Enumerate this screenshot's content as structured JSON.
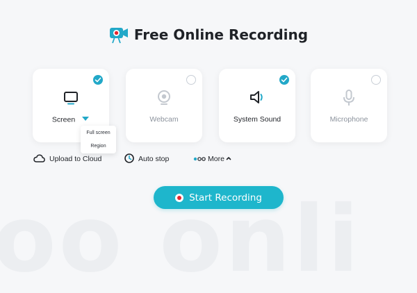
{
  "header": {
    "title": "Free Online Recording"
  },
  "cards": [
    {
      "label": "Screen",
      "checked": true,
      "icon": "monitor-icon"
    },
    {
      "label": "Webcam",
      "checked": false,
      "icon": "webcam-icon"
    },
    {
      "label": "System Sound",
      "checked": true,
      "icon": "speaker-icon"
    },
    {
      "label": "Microphone",
      "checked": false,
      "icon": "microphone-icon"
    }
  ],
  "screen_dropdown": {
    "options": [
      "Full screen",
      "Region"
    ]
  },
  "options": {
    "upload": "Upload to Cloud",
    "autostop": "Auto stop",
    "more": "More"
  },
  "start_button": {
    "label": "Start Recording"
  },
  "colors": {
    "accent": "#1eb6cc",
    "record_red": "#e5262f"
  }
}
